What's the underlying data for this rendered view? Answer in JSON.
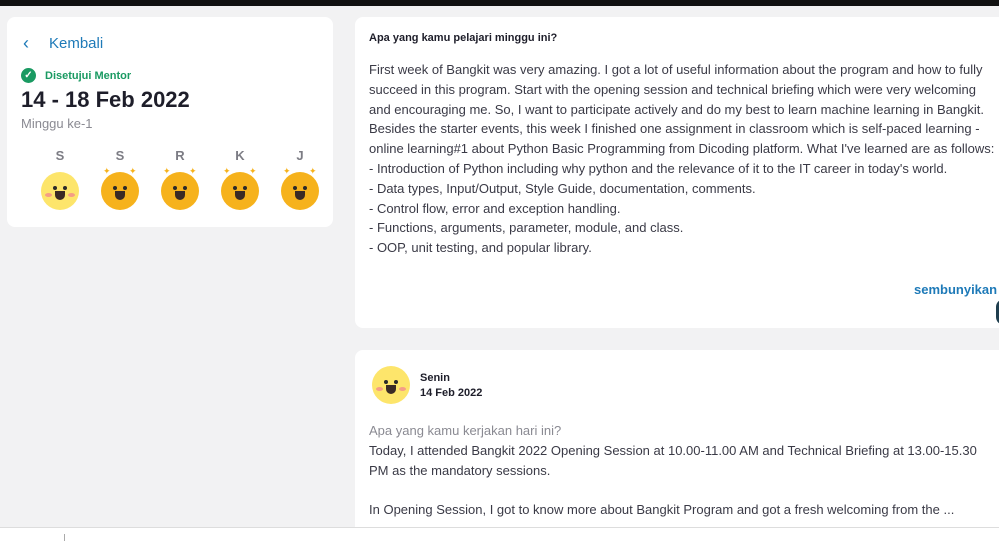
{
  "nav": {
    "back_label": "Kembali"
  },
  "summary": {
    "status": "Disetujui Mentor",
    "period": "14 - 18 Feb 2022",
    "week": "Minggu ke-1",
    "days": [
      {
        "label": "S",
        "mood": "ok"
      },
      {
        "label": "S",
        "mood": "great"
      },
      {
        "label": "R",
        "mood": "great"
      },
      {
        "label": "K",
        "mood": "great"
      },
      {
        "label": "J",
        "mood": "great"
      }
    ]
  },
  "reflection": {
    "question": "Apa yang kamu pelajari minggu ini?",
    "answer": "First week of Bangkit was very amazing. I got a lot of useful information about the program and how to fully succeed in this program. Start with the opening session and technical briefing which were very welcoming and encouraging me. So, I want to participate actively and do my best to learn machine learning in Bangkit. Besides the starter events, this week I  finished one assignment in classroom which is self-paced learning - online learning#1 about Python Basic Programming from Dicoding platform. What I've learned are as follows:\n- Introduction of Python including why python and the relevance of it to the IT career in today's world.\n- Data types, Input/Output, Style Guide, documentation, comments.\n- Control flow, error and exception handling.\n- Functions, arguments, parameter, module, and class.\n- OOP, unit testing, and popular library.",
    "hide_label": "sembunyikan"
  },
  "day_entry": {
    "day": "Senin",
    "date": "14 Feb 2022",
    "mood": "ok",
    "question": "Apa yang kamu kerjakan hari ini?",
    "answer": "Today, I attended Bangkit 2022 Opening Session at 10.00-11.00 AM and Technical Briefing at 13.00-15.30 PM as the mandatory sessions.\n\nIn Opening Session, I got to know more about Bangkit Program and got a fresh welcoming from the ..."
  }
}
